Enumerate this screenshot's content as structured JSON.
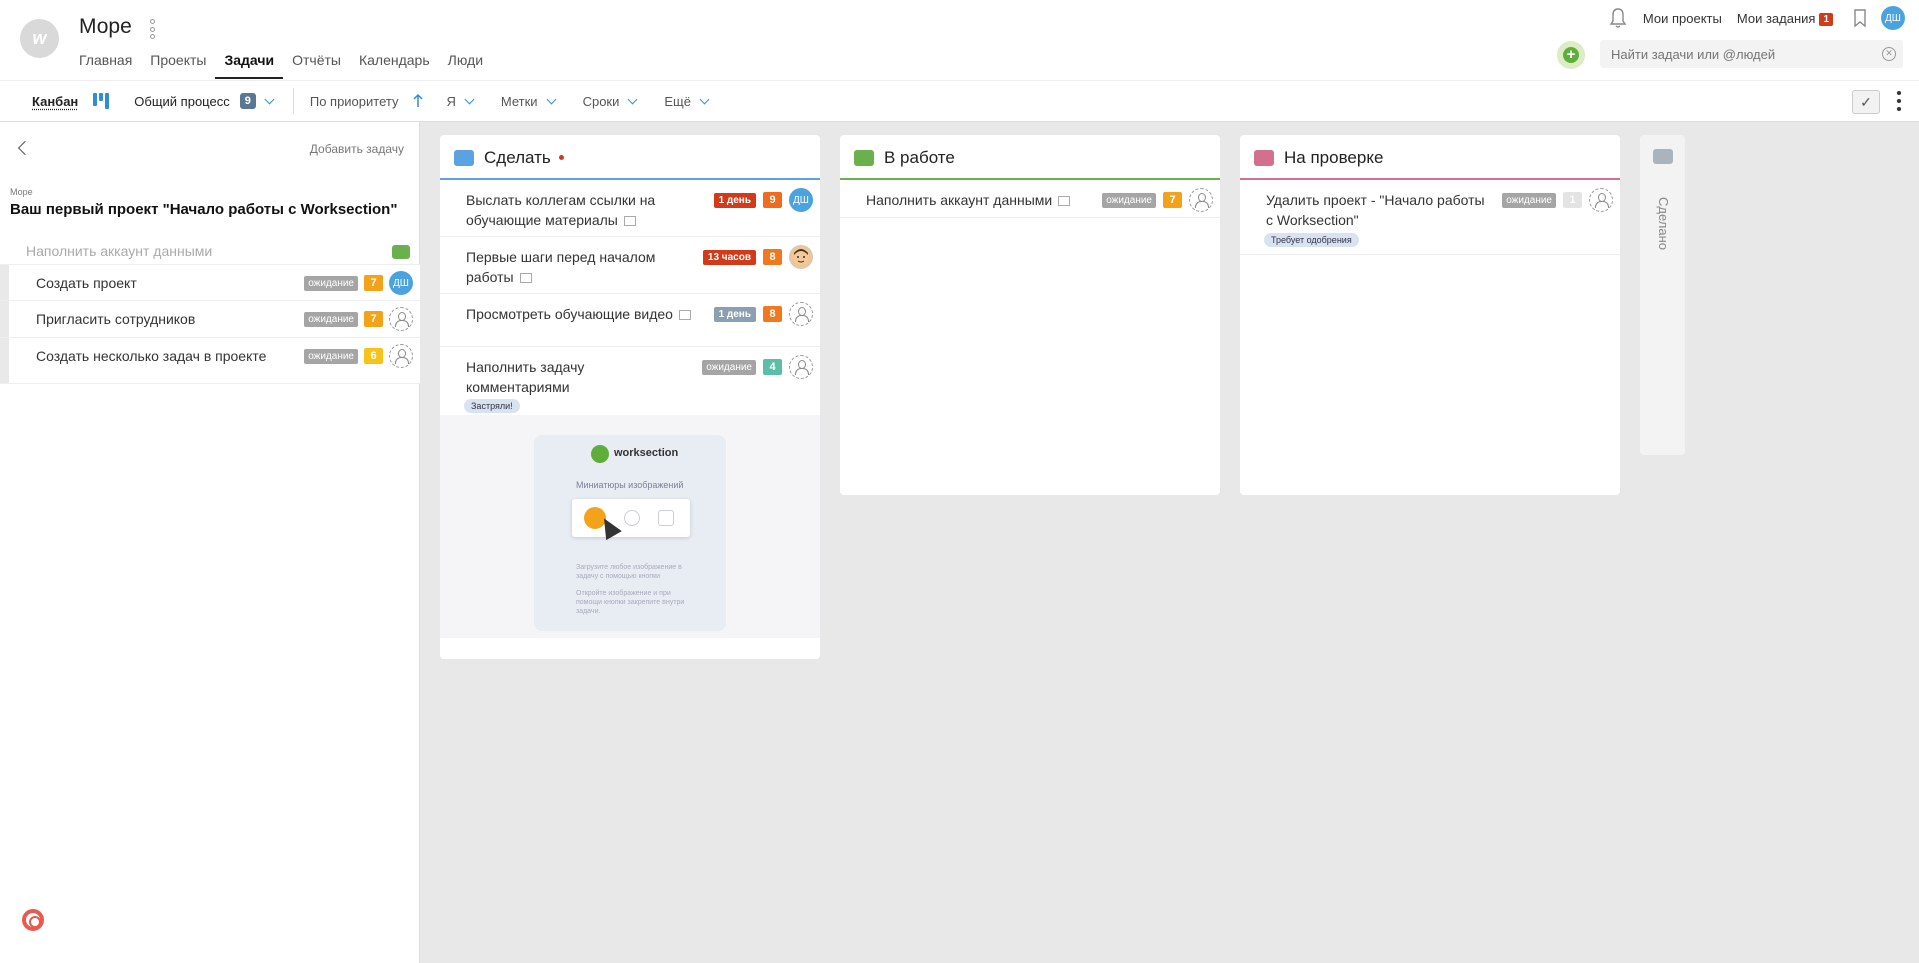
{
  "header": {
    "logo_letter": "w",
    "project_title": "Море",
    "nav": [
      {
        "label": "Главная",
        "active": false
      },
      {
        "label": "Проекты",
        "active": false
      },
      {
        "label": "Задачи",
        "active": true
      },
      {
        "label": "Отчёты",
        "active": false
      },
      {
        "label": "Календарь",
        "active": false
      },
      {
        "label": "Люди",
        "active": false
      }
    ],
    "my_projects": "Мои проекты",
    "my_tasks": "Мои задания",
    "my_tasks_count": "1",
    "user_initials": "ДШ",
    "search_placeholder": "Найти задачи или @людей"
  },
  "toolbar": {
    "view": "Канбан",
    "process": "Общий процесс",
    "process_count": "9",
    "sort": "По приоритету",
    "me": "Я",
    "tags": "Метки",
    "deadlines": "Сроки",
    "more": "Ещё"
  },
  "sidebar": {
    "add_task": "Добавить задачу",
    "breadcrumb": "Море",
    "project_title": "Ваш первый проект \"Начало работы с Worksection\"",
    "parent_task": "Наполнить аккаунт данными",
    "parent_color": "#6ab04c",
    "subtasks": [
      {
        "title": "Создать проект",
        "status": "ожидание",
        "priority": "7",
        "assignee": "ДШ"
      },
      {
        "title": "Пригласить сотрудников",
        "status": "ожидание",
        "priority": "7",
        "assignee": ""
      },
      {
        "title": "Создать несколько задач в проекте",
        "status": "ожидание",
        "priority": "6",
        "assignee": ""
      }
    ]
  },
  "columns": {
    "todo": {
      "title": "Сделать",
      "color": "#5aa2e0",
      "cards": [
        {
          "title": "Выслать коллегам ссылки на обучающие материалы",
          "deadline": "1 день",
          "priority": "9",
          "assignee": "ДШ"
        },
        {
          "title": "Первые шаги перед началом работы",
          "deadline": "13 часов",
          "priority": "8",
          "assignee": ""
        },
        {
          "title": "Просмотреть обучающие видео",
          "deadline": "1 день",
          "priority": "8",
          "assignee": ""
        },
        {
          "title": "Наполнить задачу комментариями",
          "status": "ожидание",
          "priority": "4",
          "tag": "Застряли!",
          "assignee": ""
        }
      ],
      "thumbnail": {
        "brand": "worksection",
        "heading": "Миниатюры изображений",
        "line1": "Загрузите любое изображение в задачу с помощью кнопки",
        "line2": "Откройте изображение и при помощи кнопки закрепите внутри задачи."
      }
    },
    "work": {
      "title": "В работе",
      "color": "#6ab04c",
      "cards": [
        {
          "title": "Наполнить аккаунт данными",
          "status": "ожидание",
          "priority": "7",
          "assignee": ""
        }
      ]
    },
    "review": {
      "title": "На проверке",
      "color": "#d3708f",
      "cards": [
        {
          "title": "Удалить проект - \"Начало работы с Worksection\"",
          "status": "ожидание",
          "priority": "1",
          "tag": "Требует одобрения",
          "assignee": ""
        }
      ]
    },
    "done": {
      "title": "Сделано",
      "color": "#aab4bd"
    }
  }
}
